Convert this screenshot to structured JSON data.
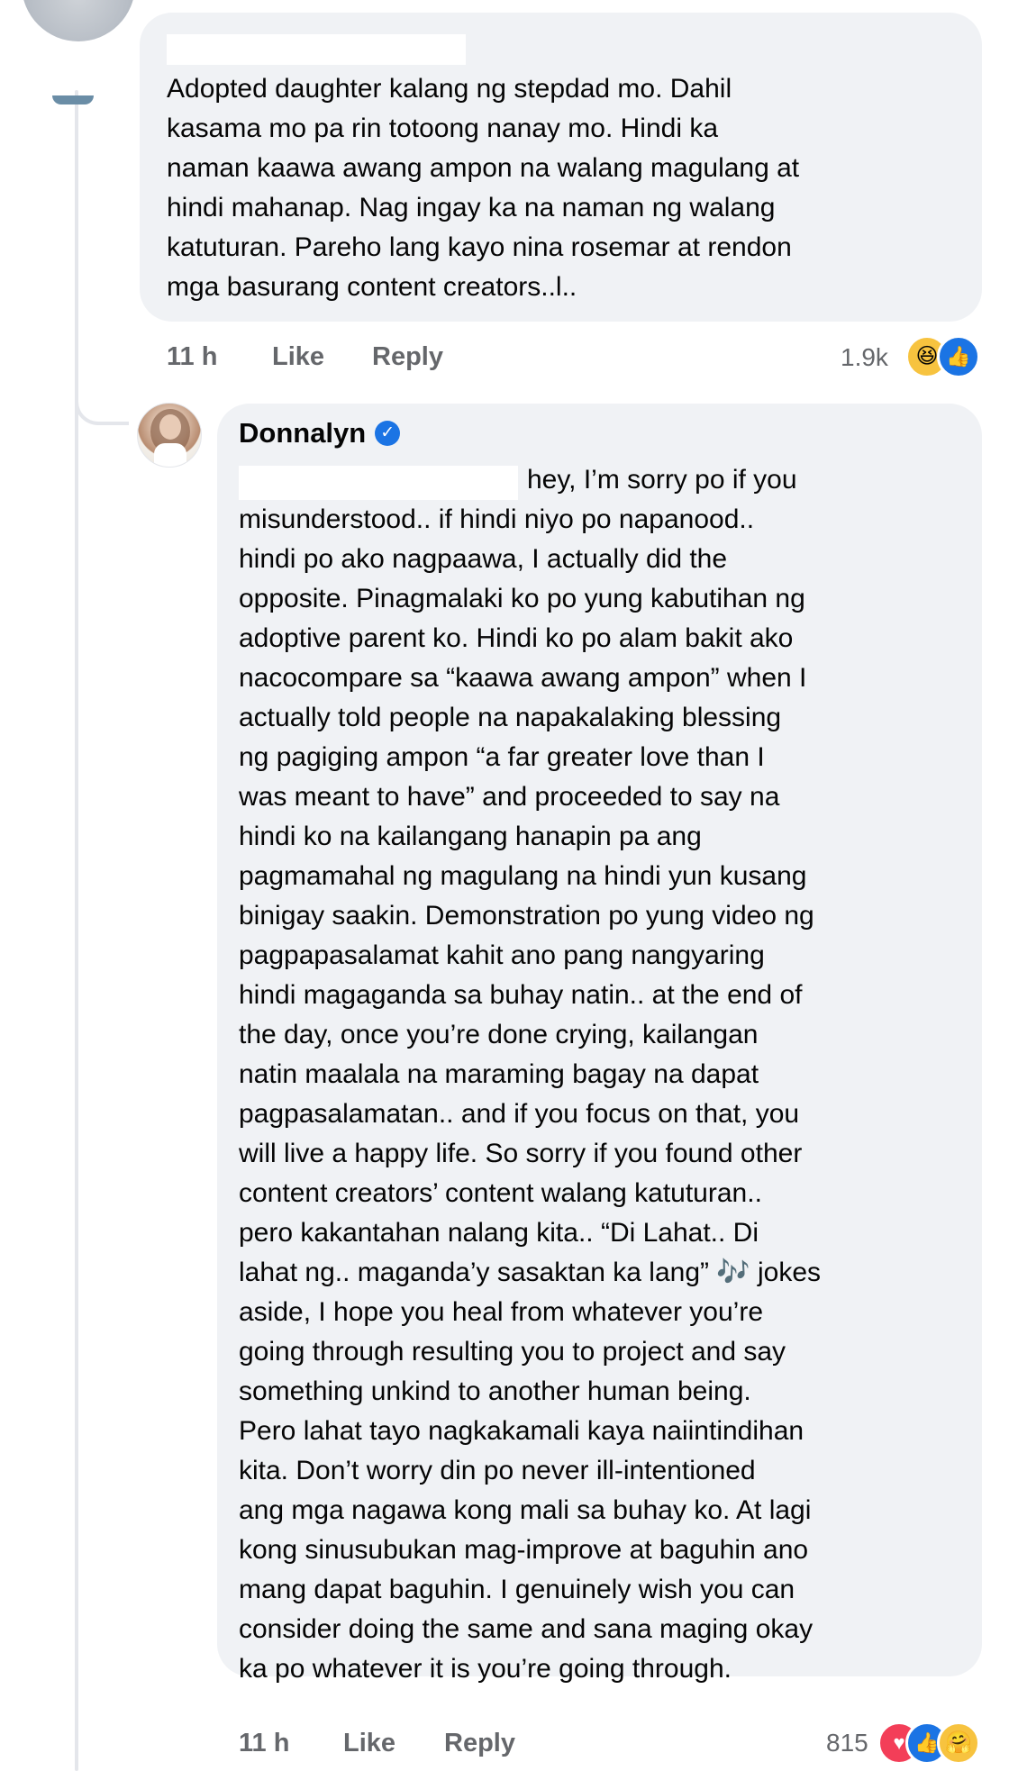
{
  "comment1": {
    "text": "Adopted daughter kalang ng stepdad mo. Dahil\nkasama mo pa rin totoong nanay mo. Hindi ka\nnaman kaawa awang ampon na walang magulang at\nhindi mahanap. Nag ingay ka na naman ng walang\nkatuturan. Pareho lang kayo nina rosemar at rendon\nmga basurang content creators..l..",
    "time": "11 h",
    "like_label": "Like",
    "reply_label": "Reply",
    "reaction_count": "1.9k",
    "reactions": [
      "haha-icon",
      "like-icon"
    ]
  },
  "reply": {
    "author": "Donnalyn",
    "verified": true,
    "text": "hey, I’m sorry po if you\nmisunderstood.. if hindi niyo po napanood..\nhindi po ako nagpaawa, I actually did the\nopposite. Pinagmalaki ko po yung kabutihan ng\nadoptive parent ko. Hindi ko po alam bakit ako\nnacocompare sa “kaawa awang ampon” when I\nactually told people na napakalaking blessing\nng pagiging ampon “a far greater love than I\nwas meant to have” and proceeded to say na\nhindi ko na kailangang hanapin pa ang\npagmamahal ng magulang na hindi yun kusang\nbinigay saakin. Demonstration po yung video ng\npagpapasalamat kahit ano pang nangyaring\nhindi magaganda sa buhay natin.. at the end of\nthe day, once you’re done crying, kailangan\nnatin maalala na maraming bagay na dapat\npagpasalamatan.. and if you focus on that, you\nwill live a happy life. So sorry if you found other\ncontent creators’ content walang katuturan..\npero kakantahan nalang kita.. “Di Lahat.. Di\nlahat ng.. maganda’y sasaktan ka lang” 🎶 jokes\naside, I hope you heal from whatever you’re\ngoing through resulting you to project and say\nsomething unkind to another human being.\nPero lahat tayo nagkakamali kaya naiintindihan\nkita. Don’t worry din po never ill-intentioned\nang mga nagawa kong mali sa buhay ko. At lagi\nkong sinusubukan mag-improve at baguhin ano\nmang dapat baguhin. I genuinely wish you can\nconsider doing the same and sana maging okay\nka po whatever it is you’re going through.",
    "time": "11 h",
    "like_label": "Like",
    "reply_label": "Reply",
    "reaction_count": "815",
    "reactions": [
      "heart-icon",
      "like-icon",
      "care-icon"
    ]
  },
  "colors": {
    "bubble": "#f0f2f5",
    "meta_text": "#65676b",
    "verified_blue": "#1b74e4",
    "thread_line": "#e4e6eb"
  }
}
